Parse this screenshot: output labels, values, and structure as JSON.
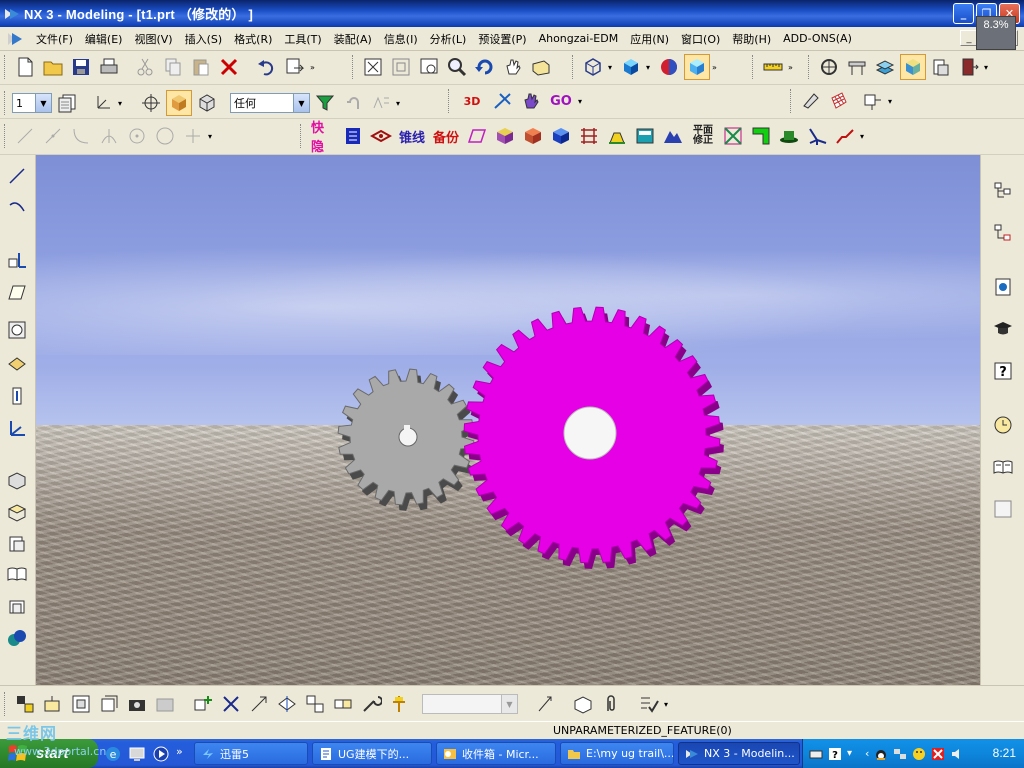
{
  "window": {
    "title": "NX 3 - Modeling - [t1.prt （修改的） ]"
  },
  "window_controls": {
    "minimize": "_",
    "restore": "❐",
    "close": "✕"
  },
  "zoom_tooltip": "8.3%",
  "menubar": {
    "items": [
      "文件(F)",
      "编辑(E)",
      "视图(V)",
      "插入(S)",
      "格式(R)",
      "工具(T)",
      "装配(A)",
      "信息(I)",
      "分析(L)",
      "预设置(P)",
      "Ahongzai-EDM",
      "应用(N)",
      "窗口(O)",
      "帮助(H)",
      "ADD-ONS(A)"
    ]
  },
  "toolbar": {
    "layer_combo": "1",
    "filter_combo": "任何",
    "cn_tools": {
      "kuaiyin": "快隐",
      "zhuixian": "锥线",
      "beifen": "备份",
      "pingmian_xiuzheng": "平面修正",
      "go": "GO",
      "three_d": "3D"
    }
  },
  "status": {
    "text": "UNPARAMETERIZED_FEATURE(0)"
  },
  "watermark": {
    "logo": "三维网",
    "sub": "www.3dportal.cn"
  },
  "taskbar": {
    "start_label": "start",
    "tasks": [
      {
        "label": "迅雷5"
      },
      {
        "label": "UG建模下的..."
      },
      {
        "label": "收件箱 - Micr..."
      },
      {
        "label": "E:\\my ug trail\\..."
      },
      {
        "label": "NX 3 - Modelin..."
      }
    ],
    "clock": "8:21"
  },
  "scene": {
    "small_gear_color": "#a9a9a9",
    "large_gear_color": "#e600e6",
    "sky_color": "#8d9ee0"
  }
}
